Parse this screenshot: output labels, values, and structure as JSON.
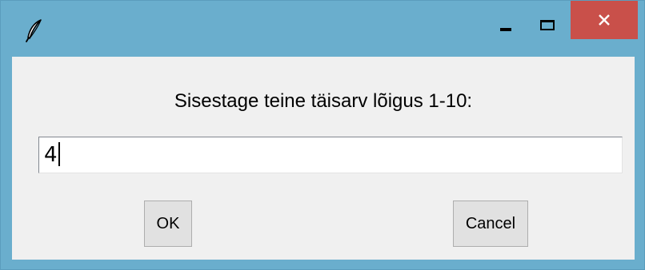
{
  "window": {
    "title": "",
    "app_icon": "feather-icon",
    "controls": {
      "minimize_icon": "minimize-icon",
      "maximize_icon": "maximize-icon",
      "close_icon": "close-icon"
    },
    "colors": {
      "titlebar": "#6aaecd",
      "close_button": "#c9504a",
      "client_background": "#f0f0f0"
    }
  },
  "dialog": {
    "prompt": "Sisestage teine täisarv lõigus 1-10:",
    "entry_value": "4",
    "ok_label": "OK",
    "cancel_label": "Cancel"
  }
}
